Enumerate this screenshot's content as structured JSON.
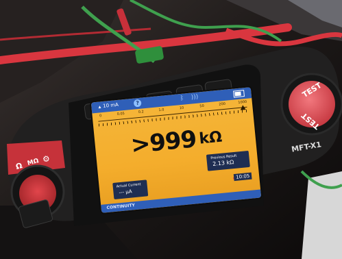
{
  "scene": {
    "colors": {
      "background": "#1a1616",
      "cable_red": "#d9363f",
      "cable_green": "#3fa04e",
      "body": "#212020",
      "lcd": "#f4ad2c",
      "status_blue": "#2f5fb8",
      "test_button": "#e8555c"
    }
  },
  "device": {
    "model": "MFT-X1",
    "test_button_label": "TEST",
    "mode_labels": [
      "Ω",
      "MΩ"
    ],
    "mode_icon": "gear-icon"
  },
  "display": {
    "status_bar": {
      "range": "10 mA",
      "help_icon": "?",
      "bluetooth_icon": "bluetooth-icon"
    },
    "scale_ticks": [
      "0",
      "0.05",
      "0.2",
      "1.0",
      "10",
      "50",
      "200",
      "1000"
    ],
    "reading_value": ">999",
    "reading_unit": "kΩ",
    "previous_result": {
      "label": "Previous Result",
      "value": "2.13 kΩ"
    },
    "actual_current": {
      "label": "Actual Current",
      "value": "--- µA"
    },
    "time": "10:05",
    "mode": "CONTINUITY"
  }
}
